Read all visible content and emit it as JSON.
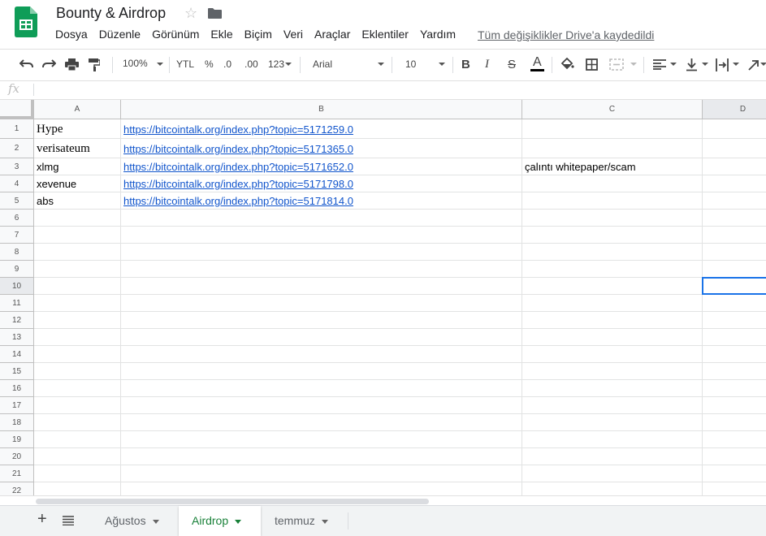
{
  "doc": {
    "title": "Bounty & Airdrop",
    "saved_status": "Tüm değişiklikler Drive'a kaydedildi"
  },
  "menu": [
    "Dosya",
    "Düzenle",
    "Görünüm",
    "Ekle",
    "Biçim",
    "Veri",
    "Araçlar",
    "Eklentiler",
    "Yardım"
  ],
  "toolbar": {
    "zoom": "100%",
    "currency": "YTL",
    "percent": "%",
    "dec_less": ".0",
    "dec_more": ".00",
    "format": "123",
    "font": "Arial",
    "font_size": "10",
    "bold": "B",
    "italic": "I",
    "strike": "S",
    "text_color": "A"
  },
  "formula_bar": {
    "fx": "fx",
    "value": ""
  },
  "columns": [
    "A",
    "B",
    "C",
    "D"
  ],
  "rows": [
    "1",
    "2",
    "3",
    "4",
    "5",
    "6",
    "7",
    "8",
    "9",
    "10",
    "11",
    "12",
    "13",
    "14",
    "15",
    "16",
    "17",
    "18",
    "19",
    "20",
    "21",
    "22"
  ],
  "cells": {
    "r1": {
      "a": "Hype",
      "b": "https://bitcointalk.org/index.php?topic=5171259.0",
      "c": ""
    },
    "r2": {
      "a": "verisateum",
      "b": "https://bitcointalk.org/index.php?topic=5171365.0",
      "c": ""
    },
    "r3": {
      "a": "xlmg",
      "b": "https://bitcointalk.org/index.php?topic=5171652.0",
      "c": "çalıntı whitepaper/scam"
    },
    "r4": {
      "a": "xevenue",
      "b": "https://bitcointalk.org/index.php?topic=5171798.0",
      "c": ""
    },
    "r5": {
      "a": "abs",
      "b": "https://bitcointalk.org/index.php?topic=5171814.0",
      "c": ""
    }
  },
  "sheets": {
    "add": "+",
    "tabs": [
      "Ağustos",
      "Airdrop",
      "temmuz"
    ],
    "active": "Airdrop"
  },
  "colors": {
    "accent": "#1a73e8",
    "sheets_green": "#188038",
    "link": "#1155cc"
  }
}
